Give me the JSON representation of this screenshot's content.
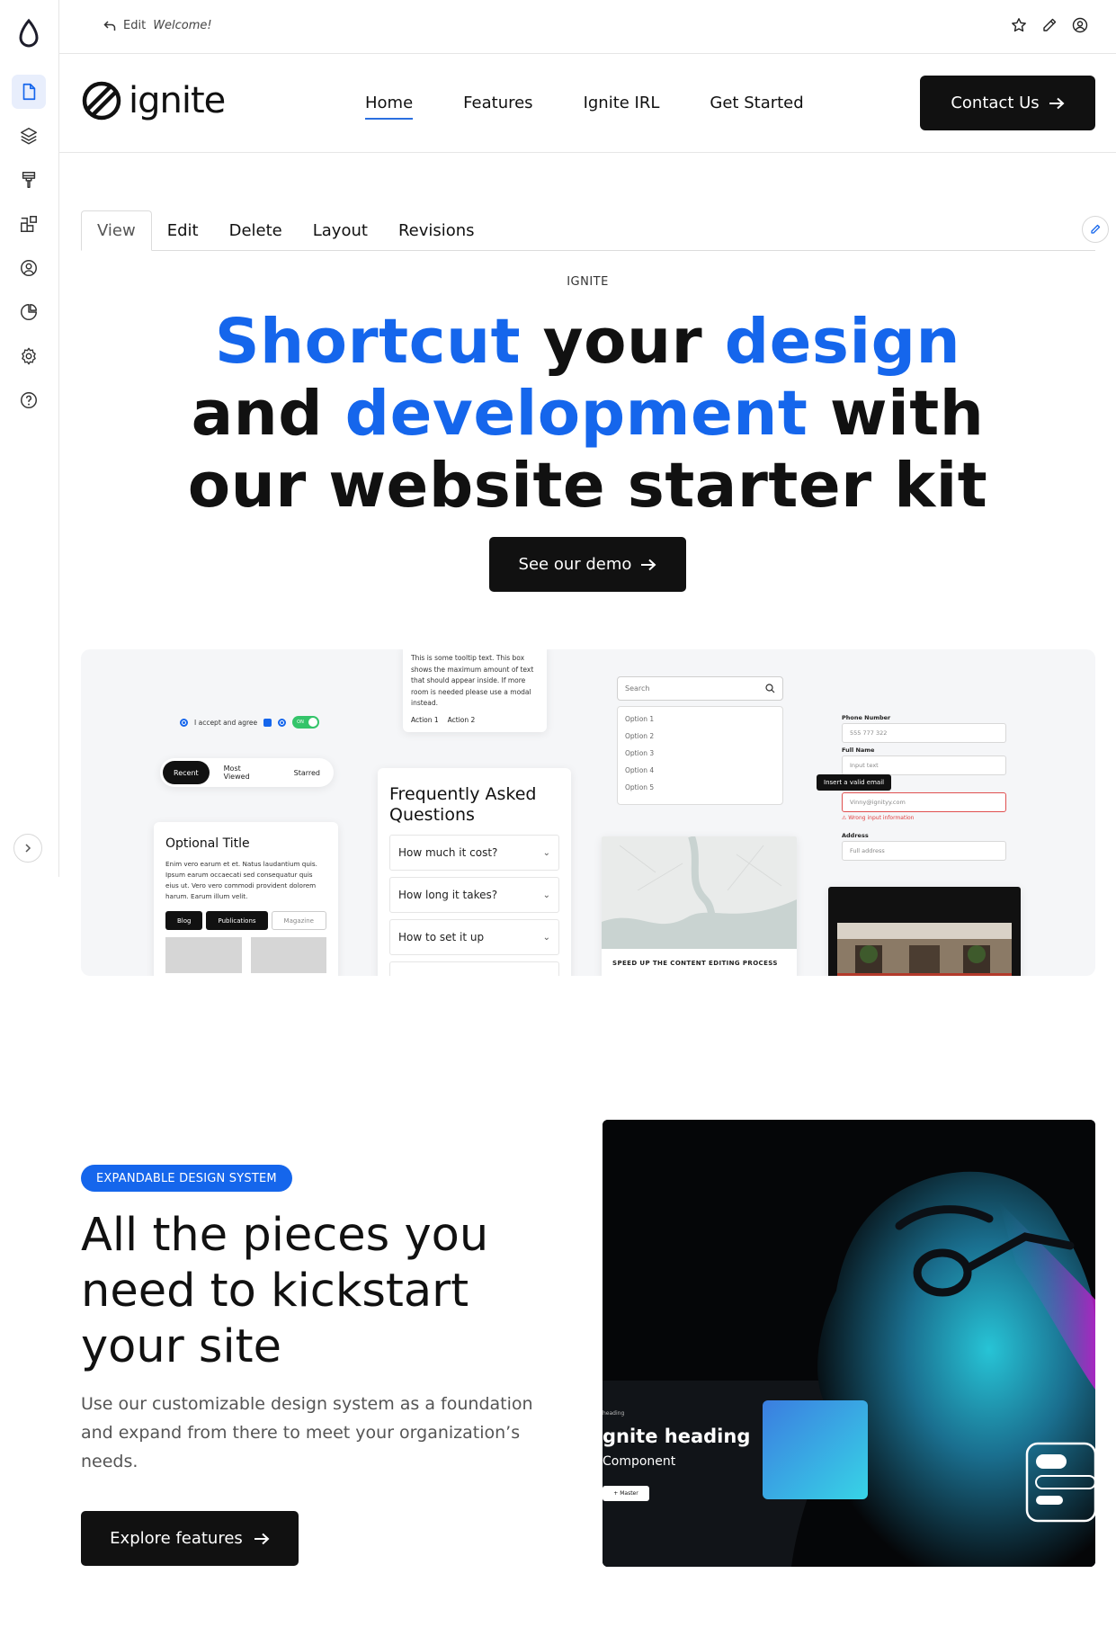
{
  "admin_topbar": {
    "edit_prefix": "Edit",
    "edit_page": "Welcome!",
    "icons": [
      "star-icon",
      "pencil-icon",
      "user-circle-icon"
    ]
  },
  "sidebar": {
    "items": [
      {
        "icon": "document-icon",
        "active": true
      },
      {
        "icon": "layers-icon"
      },
      {
        "icon": "paint-brush-icon"
      },
      {
        "icon": "blocks-icon"
      },
      {
        "icon": "user-icon"
      },
      {
        "icon": "pie-chart-icon"
      },
      {
        "icon": "gear-icon"
      },
      {
        "icon": "help-icon"
      }
    ]
  },
  "header": {
    "brand": "ignite",
    "nav": [
      "Home",
      "Features",
      "Ignite IRL",
      "Get Started"
    ],
    "current_nav": "Home",
    "contact_label": "Contact Us"
  },
  "editor_tabs": [
    "View",
    "Edit",
    "Delete",
    "Layout",
    "Revisions"
  ],
  "hero": {
    "eyebrow": "IGNITE",
    "title_parts": [
      {
        "text": "Shortcut",
        "accent": true
      },
      {
        "text": " your ",
        "accent": false
      },
      {
        "text": "design",
        "accent": true
      },
      {
        "text": " and ",
        "accent": false
      },
      {
        "text": "development",
        "accent": true
      },
      {
        "text": " with our website starter kit",
        "accent": false
      }
    ],
    "cta_label": "See our demo"
  },
  "showcase": {
    "tooltip_text": "This is some tooltip text. This box shows the maximum amount of text that should appear inside. If more room is needed please use a modal instead.",
    "tooltip_actions": [
      "Action 1",
      "Action 2"
    ],
    "consent_label": "I accept and agree",
    "toggle_label": "ON",
    "pill_tabs": [
      "Recent",
      "Most Viewed",
      "Starred"
    ],
    "card_title": "Optional Title",
    "card_text": "Enim vero earum et et. Natus laudantium quis. Ipsum earum occaecati sed consequatur quis eius ut. Vero vero commodi provident dolorem harum. Earum illum velit.",
    "card_tags": [
      "Blog",
      "Publications",
      "Magazine"
    ],
    "faq_title": "Frequently Asked Questions",
    "faq_items": [
      "How much it cost?",
      "How long it takes?",
      "How to set it up"
    ],
    "search_placeholder": "Search",
    "options": [
      "Option 1",
      "Option 2",
      "Option 3",
      "Option 4",
      "Option 5"
    ],
    "map_caption": "SPEED UP THE CONTENT EDITING PROCESS",
    "form": {
      "phone_label": "Phone Number",
      "phone_value": "555 777 322",
      "name_label": "Full Name",
      "name_placeholder": "Input text",
      "email_value": "Vinny@ignityy.com",
      "error_text": "Wrong input information",
      "tip_text": "Insert a valid email",
      "address_label": "Address",
      "address_placeholder": "Full address"
    }
  },
  "feature": {
    "badge": "EXPANDABLE DESIGN SYSTEM",
    "title": "All the pieces you need to kickstart your site",
    "description": "Use our customizable design system as a foundation and expand from there to meet your organization’s needs.",
    "cta_label": "Explore features",
    "overlay_kicker": "heading",
    "overlay_heading": "gnite heading",
    "overlay_sub": "Component",
    "overlay_btn": "+ Master"
  },
  "colors": {
    "accent": "#1566ec",
    "dark": "#111111",
    "border": "#e6e6e6"
  }
}
